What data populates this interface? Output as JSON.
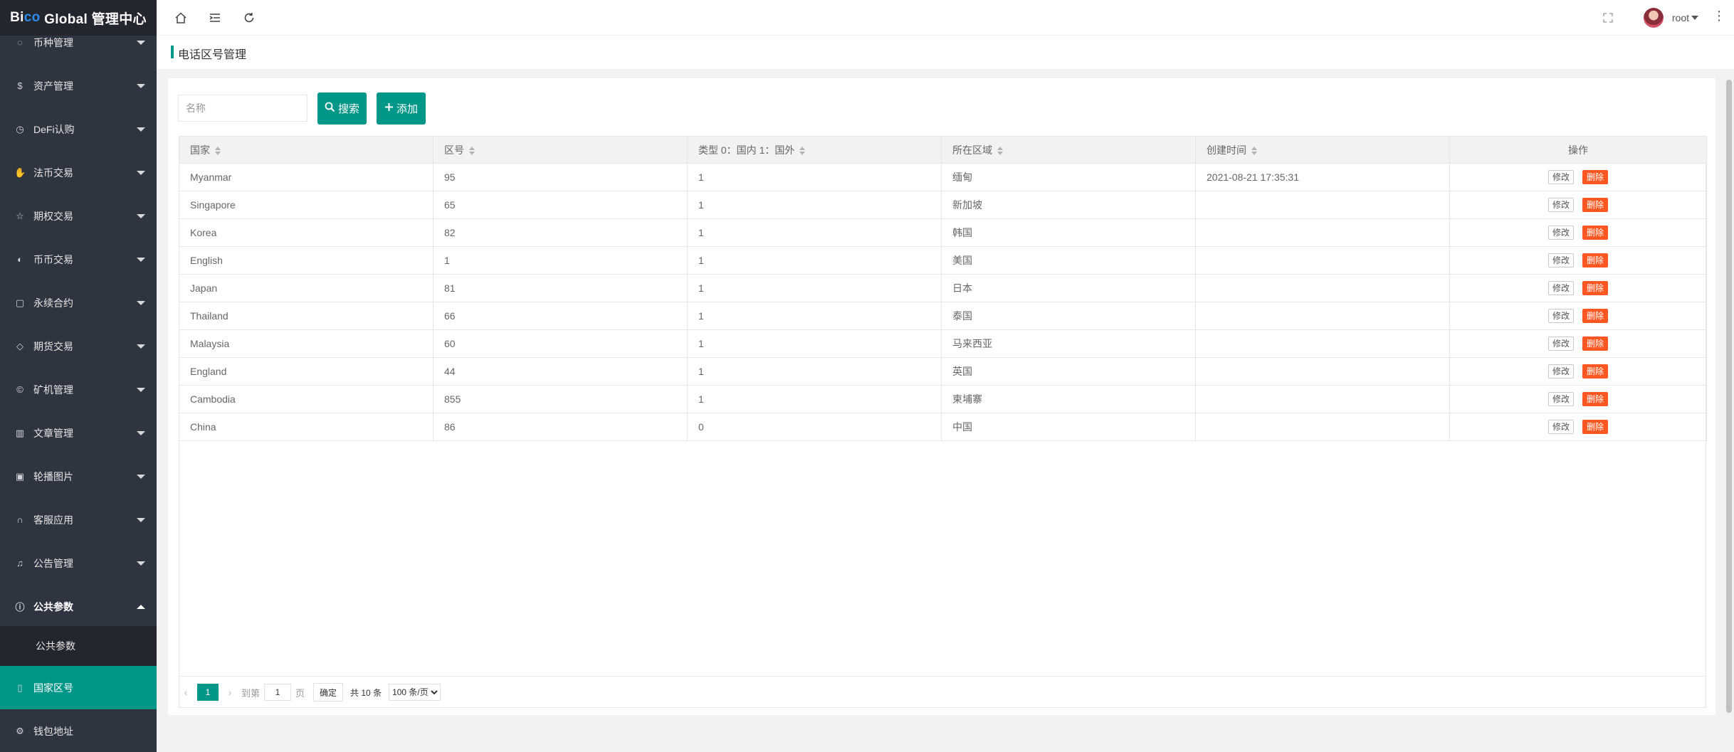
{
  "app": {
    "logo_prefix": "Bi",
    "logo_accent": "co",
    "logo_suffix": " Global 管理中心"
  },
  "sidebar": {
    "items": [
      {
        "label": "币种管理",
        "icon": "coin-icon"
      },
      {
        "label": "资产管理",
        "icon": "dollar-icon"
      },
      {
        "label": "DeFi认购",
        "icon": "clock-icon"
      },
      {
        "label": "法币交易",
        "icon": "hand-icon"
      },
      {
        "label": "期权交易",
        "icon": "star-icon"
      },
      {
        "label": "币币交易",
        "icon": "exchange-icon"
      },
      {
        "label": "永续合约",
        "icon": "file-icon"
      },
      {
        "label": "期货交易",
        "icon": "diamond-icon"
      },
      {
        "label": "矿机管理",
        "icon": "copyright-icon"
      },
      {
        "label": "文章管理",
        "icon": "book-icon"
      },
      {
        "label": "轮播图片",
        "icon": "picture-icon"
      },
      {
        "label": "客服应用",
        "icon": "headset-icon"
      },
      {
        "label": "公告管理",
        "icon": "bell-icon"
      },
      {
        "label": "公共参数",
        "icon": "info-icon"
      }
    ],
    "sub_item": "公共参数",
    "active_item": "国家区号",
    "wallet_item": "钱包地址"
  },
  "header": {
    "user": "root"
  },
  "page": {
    "title": "电话区号管理"
  },
  "search": {
    "placeholder": "名称",
    "search_label": "搜索",
    "add_label": "添加"
  },
  "table": {
    "columns": [
      "国家",
      "区号",
      "类型 0：国内 1：国外",
      "所在区域",
      "创建时间",
      "操作"
    ],
    "edit_label": "修改",
    "delete_label": "删除",
    "rows": [
      {
        "country": "Myanmar",
        "code": "95",
        "type": "1",
        "region": "缅甸",
        "created": "2021-08-21 17:35:31"
      },
      {
        "country": "Singapore",
        "code": "65",
        "type": "1",
        "region": "新加坡",
        "created": ""
      },
      {
        "country": "Korea",
        "code": "82",
        "type": "1",
        "region": "韩国",
        "created": ""
      },
      {
        "country": "English",
        "code": "1",
        "type": "1",
        "region": "美国",
        "created": ""
      },
      {
        "country": "Japan",
        "code": "81",
        "type": "1",
        "region": "日本",
        "created": ""
      },
      {
        "country": "Thailand",
        "code": "66",
        "type": "1",
        "region": "泰国",
        "created": ""
      },
      {
        "country": "Malaysia",
        "code": "60",
        "type": "1",
        "region": "马来西亚",
        "created": ""
      },
      {
        "country": "England",
        "code": "44",
        "type": "1",
        "region": "英国",
        "created": ""
      },
      {
        "country": "Cambodia",
        "code": "855",
        "type": "1",
        "region": "柬埔寨",
        "created": ""
      },
      {
        "country": "China",
        "code": "86",
        "type": "0",
        "region": "中国",
        "created": ""
      }
    ]
  },
  "pager": {
    "current": "1",
    "goto_label": "到第",
    "goto_value": "1",
    "page_label": "页",
    "ok_label": "确定",
    "total_label": "共 10 条",
    "page_size": "100 条/页"
  },
  "colors": {
    "accent": "#009688",
    "danger": "#ff5722",
    "sidebar": "#2f3441"
  }
}
